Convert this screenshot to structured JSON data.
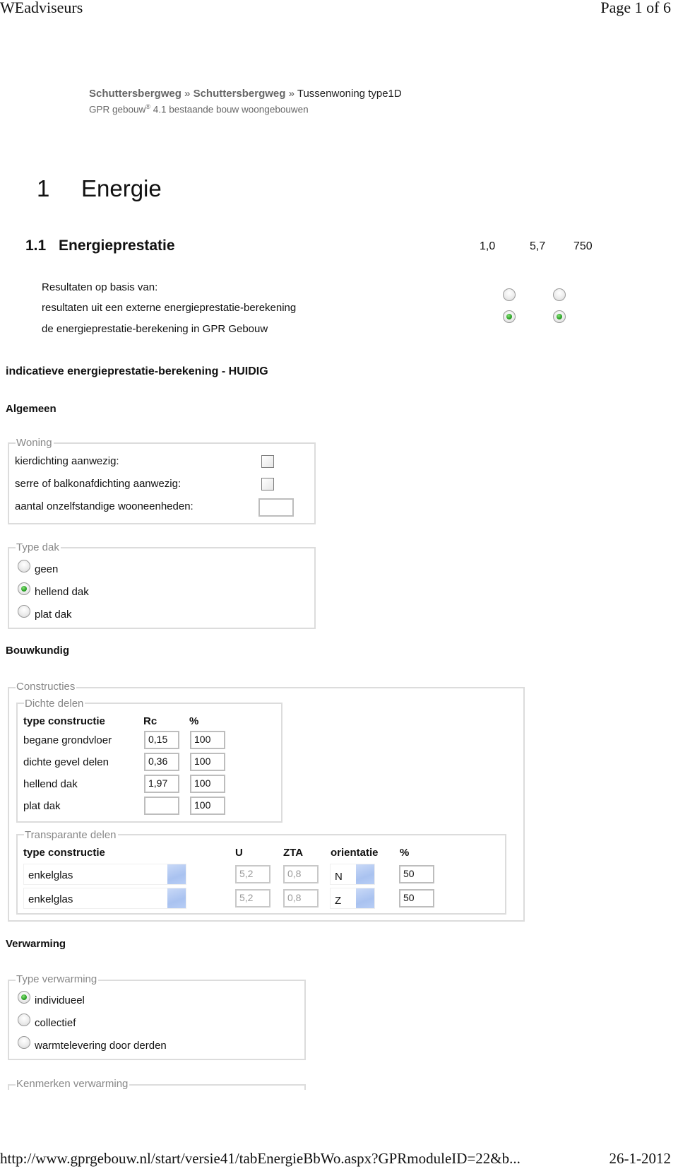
{
  "print_header": {
    "site": "WEadviseurs",
    "page": "Page 1 of 6"
  },
  "print_footer": {
    "url": "http://www.gprgebouw.nl/start/versie41/tabEnergieBbWo.aspx?GPRmoduleID=22&b...",
    "date": "26-1-2012"
  },
  "breadcrumb": {
    "items": [
      "Schuttersbergweg",
      "Schuttersbergweg",
      "Tussenwoning type1D"
    ],
    "separator": "»"
  },
  "subtitle": {
    "prefix": "GPR gebouw",
    "trademark": "®",
    "suffix": " 4.1 bestaande bouw woongebouwen"
  },
  "chapter": {
    "number": "1",
    "title": "Energie"
  },
  "section": {
    "number": "1.1",
    "title": "Energieprestatie",
    "scores": [
      "1,0",
      "5,7",
      "750"
    ]
  },
  "results_basis": {
    "label": "Resultaten op basis van:",
    "options": [
      {
        "label": "resultaten uit een externe energieprestatie-berekening",
        "col1_checked": false,
        "col2_checked": false
      },
      {
        "label": "de energieprestatie-berekening in GPR Gebouw",
        "col1_checked": true,
        "col2_checked": true
      }
    ]
  },
  "calc_title": "indicatieve energieprestatie-berekening - HUIDIG",
  "algemeen": {
    "heading": "Algemeen",
    "woning": {
      "legend": "Woning",
      "kierdichting_label": "kierdichting aanwezig:",
      "kierdichting_checked": false,
      "serre_label": "serre of balkonafdichting aanwezig:",
      "serre_checked": false,
      "wooneenheden_label": "aantal onzelfstandige wooneenheden:",
      "wooneenheden_value": ""
    },
    "type_dak": {
      "legend": "Type dak",
      "options": [
        {
          "label": "geen",
          "checked": false
        },
        {
          "label": "hellend dak",
          "checked": true
        },
        {
          "label": "plat dak",
          "checked": false
        }
      ]
    }
  },
  "bouwkundig": {
    "heading": "Bouwkundig",
    "constructies_legend": "Constructies",
    "dichte_delen": {
      "legend": "Dichte delen",
      "headers": [
        "type constructie",
        "Rc",
        "%"
      ],
      "rows": [
        {
          "type": "begane grondvloer",
          "rc": "0,15",
          "pct": "100"
        },
        {
          "type": "dichte gevel delen",
          "rc": "0,36",
          "pct": "100"
        },
        {
          "type": "hellend dak",
          "rc": "1,97",
          "pct": "100"
        },
        {
          "type": "plat dak",
          "rc": "",
          "pct": "100"
        }
      ]
    },
    "transparante_delen": {
      "legend": "Transparante delen",
      "headers": [
        "type constructie",
        "U",
        "ZTA",
        "orientatie",
        "%"
      ],
      "rows": [
        {
          "type": "enkelglas",
          "u": "5,2",
          "zta": "0,8",
          "orientatie": "N",
          "pct": "50"
        },
        {
          "type": "enkelglas",
          "u": "5,2",
          "zta": "0,8",
          "orientatie": "Z",
          "pct": "50"
        }
      ]
    }
  },
  "verwarming": {
    "heading": "Verwarming",
    "type_verwarming": {
      "legend": "Type verwarming",
      "options": [
        {
          "label": "individueel",
          "checked": true
        },
        {
          "label": "collectief",
          "checked": false
        },
        {
          "label": "warmtelevering door derden",
          "checked": false
        }
      ]
    },
    "kenmerken_legend": "Kenmerken verwarming"
  },
  "colors": {
    "radio_checked": "#2ea62a",
    "fieldset_border": "#dcdcdc",
    "legend_text": "#888888",
    "dropdown_button": "#b7cdf5",
    "breadcrumb_link": "#666666"
  }
}
